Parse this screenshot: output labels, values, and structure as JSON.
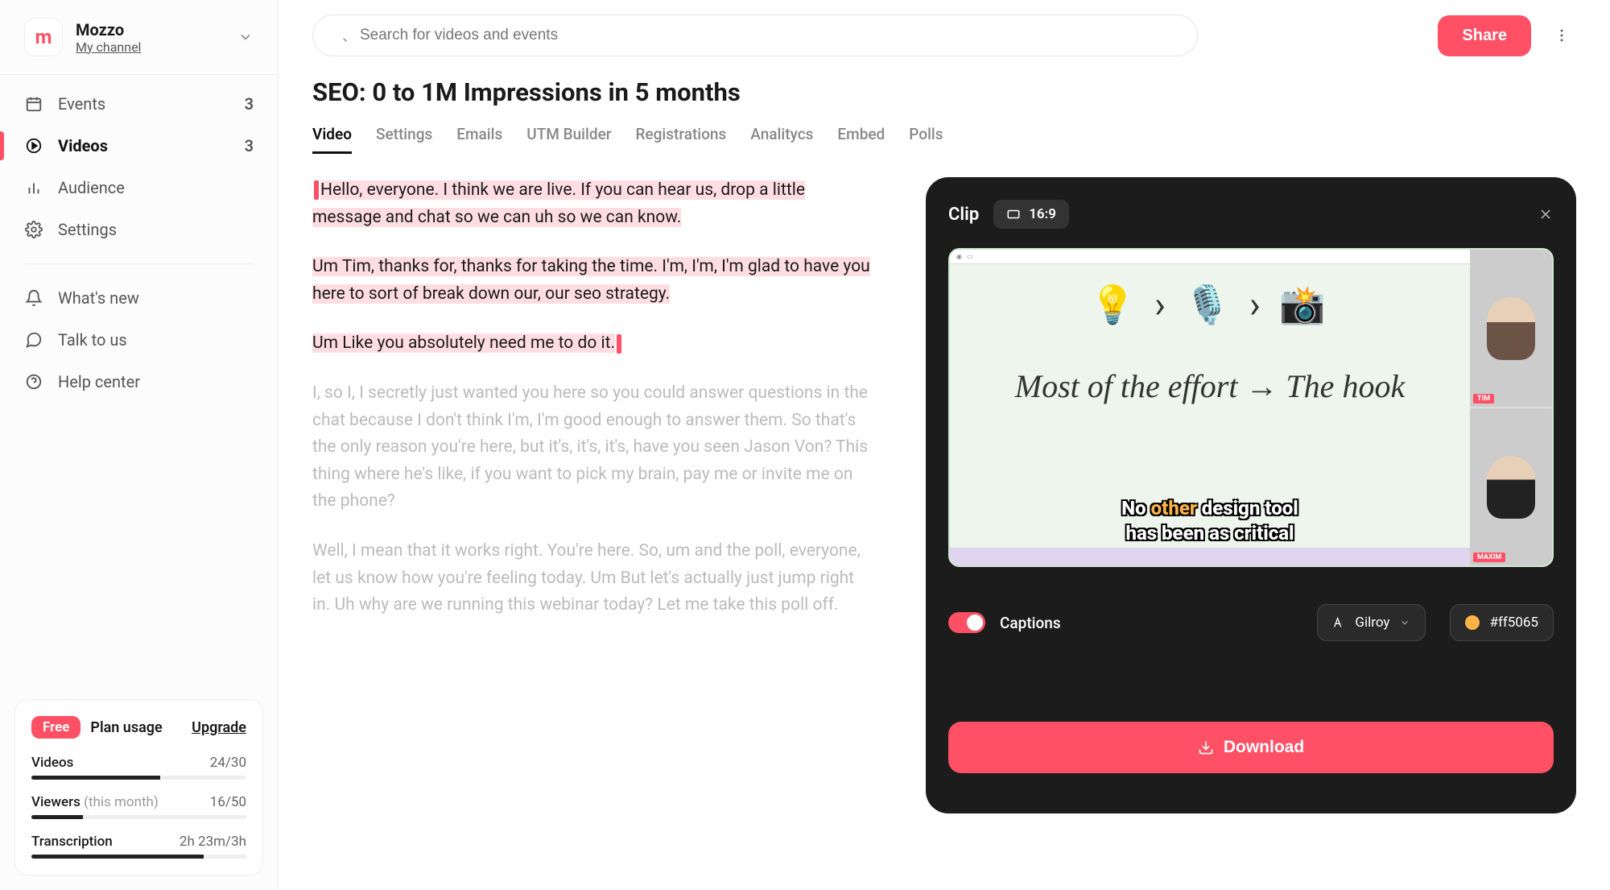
{
  "brand": {
    "name": "Mozzo",
    "subtitle": "My channel",
    "logo_letter": "m"
  },
  "nav": {
    "events": {
      "label": "Events",
      "count": "3"
    },
    "videos": {
      "label": "Videos",
      "count": "3"
    },
    "audience": {
      "label": "Audience"
    },
    "settings": {
      "label": "Settings"
    },
    "whatsnew": {
      "label": "What's new"
    },
    "talk": {
      "label": "Talk to us"
    },
    "help": {
      "label": "Help center"
    }
  },
  "plan": {
    "pill": "Free",
    "usage_label": "Plan usage",
    "upgrade": "Upgrade",
    "videos": {
      "label": "Videos",
      "value": "24/30",
      "pct": 60
    },
    "viewers": {
      "label": "Viewers",
      "sub": "(this month)",
      "value": "16/50",
      "pct": 24
    },
    "transcription": {
      "label": "Transcription",
      "value": "2h 23m/3h",
      "pct": 80
    }
  },
  "search": {
    "placeholder": "Search for videos and events"
  },
  "share_label": "Share",
  "page_title": "SEO: 0 to 1M Impressions in 5 months",
  "tabs": [
    "Video",
    "Settings",
    "Emails",
    "UTM Builder",
    "Registrations",
    "Analitycs",
    "Embed",
    "Polls"
  ],
  "transcript": {
    "p1": "Hello, everyone. I think we are live. If you can hear us, drop a little message and chat so we can uh so we can know.",
    "p2": "Um Tim, thanks for, thanks for taking the time. I'm, I'm, I'm glad to have you here to sort of break down our, our seo strategy.",
    "p3": "Um Like you absolutely need me to do it.",
    "p4": "I, so I, I secretly just wanted you here so you could answer questions in the chat because I don't think I'm, I'm good enough to answer them. So that's the only reason you're here, but it's, it's, it's, have you seen Jason Von? This thing where he's like, if you want to pick my brain, pay me or invite me on the phone?",
    "p5": "Well, I mean that it works right. You're here. So, um and the poll, everyone, let us know how you're feeling today. Um But let's actually just jump right in. Uh why are we running this webinar today? Let me take this poll off."
  },
  "clip": {
    "title": "Clip",
    "ratio": "16:9",
    "emoji_row": "💡  ›  🎙️  ›  📸",
    "hook": "Most of the effort → The hook",
    "caption_line1_pre": "No ",
    "caption_line1_hl": "other",
    "caption_line1_post": " design tool",
    "caption_line2": "has been as critical",
    "person1": "TIM",
    "person2": "MAXIM",
    "captions_label": "Captions",
    "font_name": "Gilroy",
    "color_hex": "#ff5065",
    "download": "Download"
  }
}
